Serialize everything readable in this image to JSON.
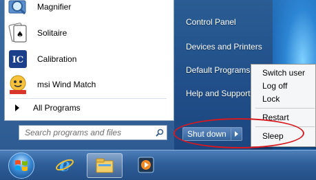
{
  "programs": [
    {
      "label": "Magnifier",
      "icon": "magnifier-icon"
    },
    {
      "label": "Solitaire",
      "icon": "solitaire-icon"
    },
    {
      "label": "Calibration",
      "icon": "calibration-icon"
    },
    {
      "label": "msi Wind Match",
      "icon": "msi-wind-match-icon"
    }
  ],
  "all_programs": "All Programs",
  "search": {
    "placeholder": "Search programs and files",
    "icon": "search-icon"
  },
  "right_items": [
    "Control Panel",
    "Devices and Printers",
    "Default Programs",
    "Help and Support"
  ],
  "shutdown": {
    "label": "Shut down",
    "icon": "chevron-right-icon"
  },
  "power_menu": [
    "Switch user",
    "Log off",
    "Lock",
    "Restart",
    "Sleep"
  ],
  "taskbar": {
    "start_icon": "windows-orb-icon",
    "pinned": [
      "internet-explorer-icon",
      "windows-explorer-icon",
      "media-player-icon"
    ]
  },
  "colors": {
    "highlight": "#d71920",
    "menu_right": "#22508a",
    "taskbar": "#2f5e98"
  }
}
